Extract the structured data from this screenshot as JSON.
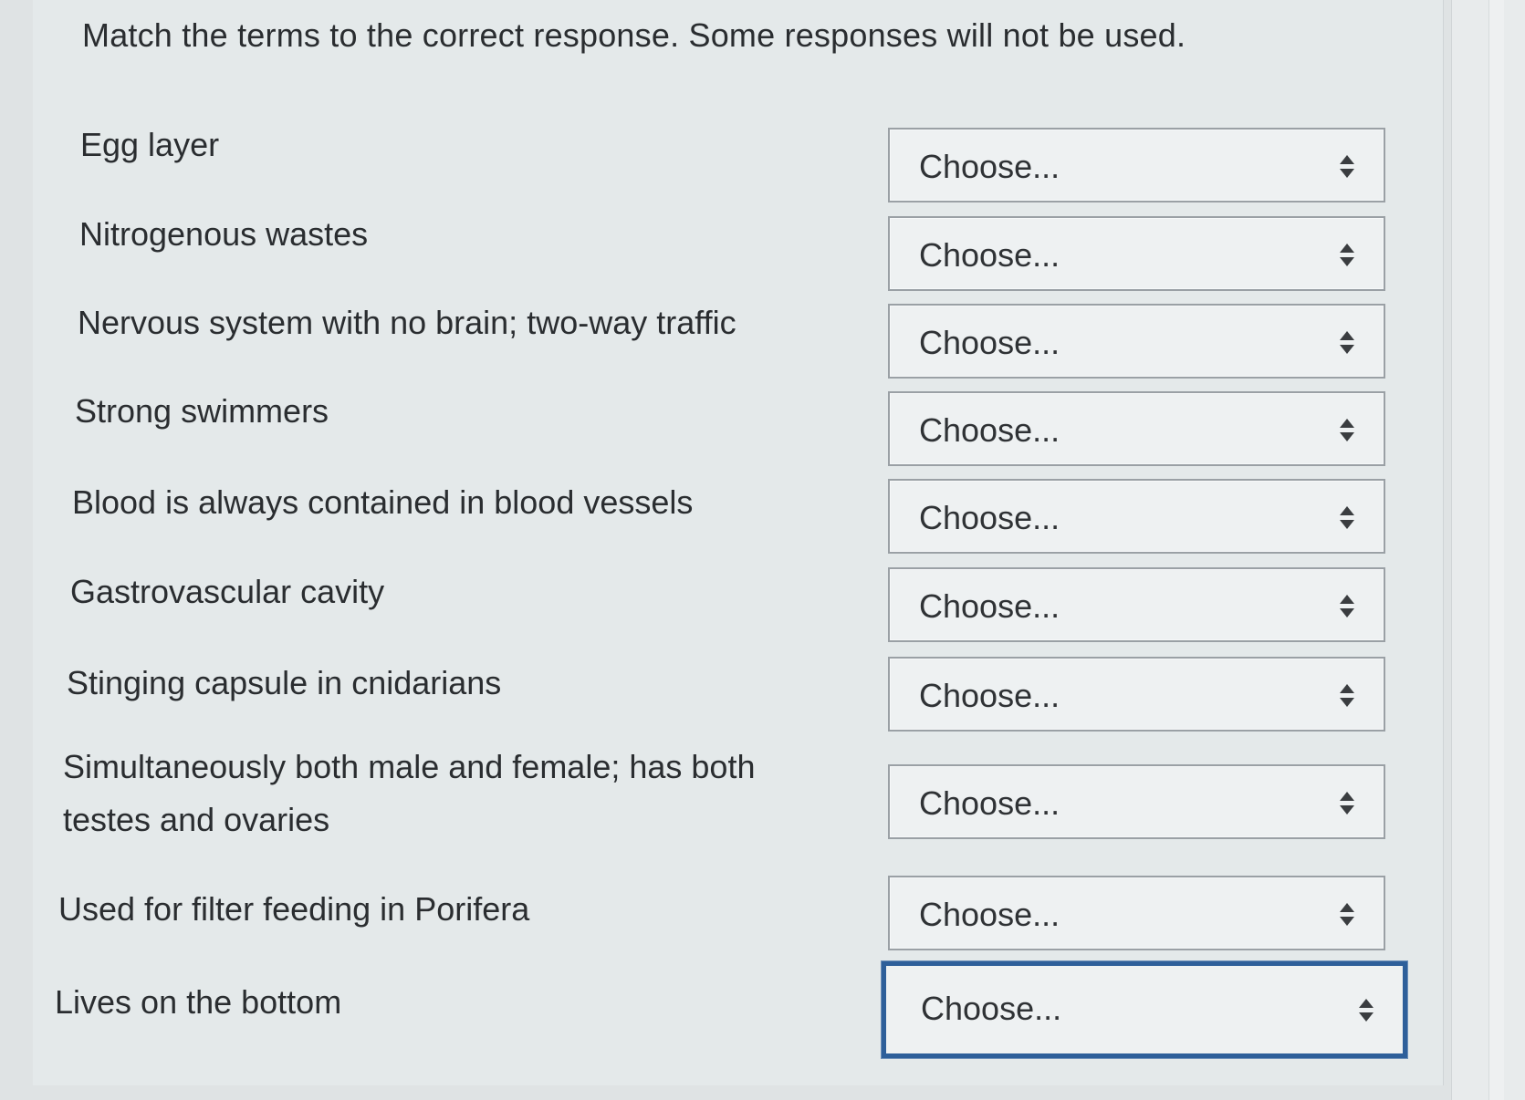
{
  "question": "Match the terms to the correct response. Some responses will not be used.",
  "rows": [
    {
      "term": "Egg layer",
      "selected": "Choose..."
    },
    {
      "term": "Nitrogenous wastes",
      "selected": "Choose..."
    },
    {
      "term": "Nervous system with no brain; two-way traffic",
      "selected": "Choose..."
    },
    {
      "term": "Strong swimmers",
      "selected": "Choose..."
    },
    {
      "term": "Blood is always contained in blood vessels",
      "selected": "Choose..."
    },
    {
      "term": "Gastrovascular cavity",
      "selected": "Choose..."
    },
    {
      "term": "Stinging capsule in cnidarians",
      "selected": "Choose..."
    },
    {
      "term": "Simultaneously both male and female; has both testes and ovaries",
      "selected": "Choose..."
    },
    {
      "term": "Used for filter feeding in Porifera",
      "selected": "Choose..."
    },
    {
      "term": "Lives on the bottom",
      "selected": "Choose..."
    }
  ],
  "icons": {
    "dropdown": "updown-arrows-icon"
  },
  "colors": {
    "focus_border": "#2e5f9a",
    "background": "#e4e9ea"
  }
}
